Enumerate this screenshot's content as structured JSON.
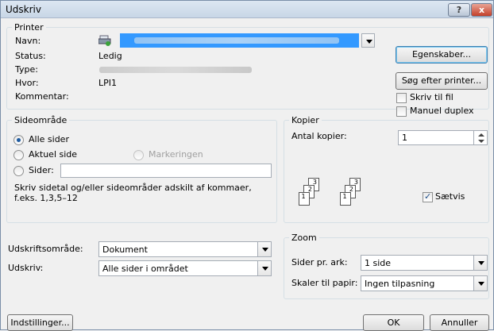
{
  "window": {
    "title": "Udskriv",
    "help": "?",
    "close": "x"
  },
  "printer": {
    "group_title": "Printer",
    "name_label": "Navn:",
    "status_label": "Status:",
    "status_value": "Ledig",
    "type_label": "Type:",
    "where_label": "Hvor:",
    "where_value": "LPI1",
    "comment_label": "Kommentar:",
    "properties_button": "Egenskaber...",
    "find_printer_button": "Søg efter printer...",
    "print_to_file": "Skriv til fil",
    "print_to_file_checked": false,
    "manual_duplex": "Manuel duplex",
    "manual_duplex_checked": false
  },
  "page_range": {
    "group_title": "Sideområde",
    "all_pages": "Alle sider",
    "current_page": "Aktuel side",
    "selection": "Markeringen",
    "pages": "Sider:",
    "pages_value": "",
    "hint_line1": "Skriv sidetal og/eller sideområder adskilt af kommaer,",
    "hint_line2": "f.eks. 1,3,5–12",
    "selected": "all"
  },
  "copies": {
    "group_title": "Kopier",
    "count_label": "Antal kopier:",
    "count_value": "1",
    "collate": "Sætvis",
    "collate_checked": true,
    "stack_labels": [
      "3",
      "2",
      "1"
    ]
  },
  "print_what": {
    "label": "Udskriftsområde:",
    "value": "Dokument",
    "print_label": "Udskriv:",
    "print_value": "Alle sider i området"
  },
  "zoom": {
    "group_title": "Zoom",
    "pages_per_sheet_label": "Sider pr. ark:",
    "pages_per_sheet_value": "1 side",
    "scale_label": "Skaler til papir:",
    "scale_value": "Ingen tilpasning"
  },
  "footer": {
    "options_button": "Indstillinger...",
    "ok_button": "OK",
    "cancel_button": "Annuller"
  }
}
